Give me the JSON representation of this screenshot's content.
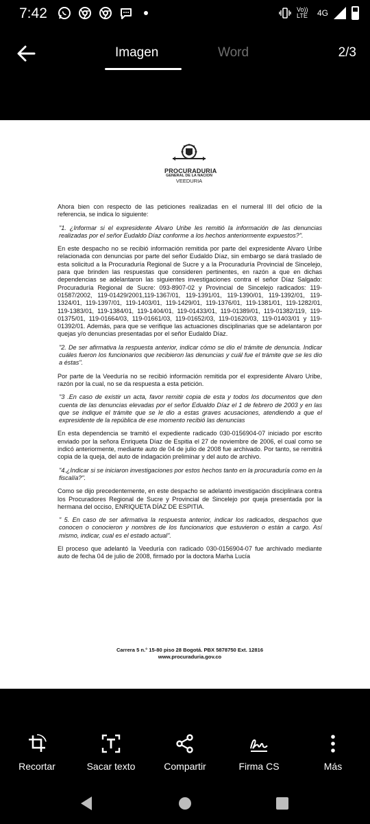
{
  "status": {
    "time": "7:42",
    "volte": "Vo)) LTE",
    "network": "4G"
  },
  "header": {
    "tabs": [
      "Imagen",
      "Word"
    ],
    "active_tab": "Imagen",
    "page_indicator": "2/3"
  },
  "document": {
    "logo": {
      "name": "PROCURADURIA",
      "subtitle": "GENERAL DE LA NACION",
      "unit": "VEEDURIA"
    },
    "paragraphs": [
      {
        "style": "normal",
        "text": "Ahora bien con respecto de las peticiones realizadas en el numeral III del oficio de la referencia, se indica lo siguiente:"
      },
      {
        "style": "italic",
        "text": "\"1. ¿Informar si el expresidente Alvaro Uribe les remitió la información de las denuncias realizadas por el señor Eudaldo Díaz conforme a los hechos anteriormente expuestos?\"."
      },
      {
        "style": "normal",
        "text": "En este despacho no se recibió información remitida por parte del expresidente Alvaro Uribe relacionada con denuncias por parte del señor Eudaldo Díaz, sin embargo se dará traslado de esta solicitud a la Procuraduría Regional de Sucre y a la Procuraduría Provincial de Sincelejo, para que brinden las respuestas que consideren pertinentes, en razón a que en dichas dependencias se adelantaron las siguientes investigaciones contra el señor Díaz Salgado: Procuraduría Regional de Sucre: 093-8907-02 y Provincial de Sincelejo radicados: 119-01587/2002, 119-01429/2001,119-1367/01, 119-1391/01, 119-1390/01, 119-1392/01, 119-1324/01, 119-1397/01, 119-1403/01, 119-1429/01, 119-1376/01, 119-1381/01, 119-1282/01, 119-1383/01, 119-1384/01, 119-1404/01, 119-01433/01, 119-01389/01, 119-01382/119, 119-01375/01, 119-01664/03, 119-01661/03, 119-01652/03, 119-01620/03, 119-01403/01 y 119-01392/01. Además, para que se verifique las actuaciones disciplinarias que se adelantaron por quejas y/o denuncias presentadas por el señor Eudaldo Díaz."
      },
      {
        "style": "italic",
        "text": "\"2. De ser afirmativa la respuesta anterior, indicar cómo se dio el trámite de denuncia. Indicar cuáles fueron los funcionarios que recibieron las denuncias y cuál fue el trámite que se les dio a éstas\"."
      },
      {
        "style": "normal",
        "text": "Por parte de la Veeduría no se recibió información remitida por el expresidente Alvaro Uribe, razón por la cual, no se da respuesta a esta petición."
      },
      {
        "style": "italic",
        "text": "\"3 .En caso de existir un acta, favor remitir copia de esta y todos los documentos que den cuenta de las denuncias elevadas por el señor Edualdo Díaz el 1 de febrero de 2003 y en las que se indique el trámite que se le dio a estas graves acusaciones, atendiendo a que el expresidente de la república de ese momento recibió las denuncias"
      },
      {
        "style": "normal",
        "text": "En esta dependencia se tramitó el expediente radicado 030-0156904-07 iniciado por escrito enviado por la señora Enriqueta Díaz de Espitia el 27 de noviembre de 2006, el cual como se indicó anteriormente, mediante auto de 04 de julio de 2008 fue archivado. Por tanto, se remitirá copia de la queja, del auto de indagación preliminar y del auto de archivo."
      },
      {
        "style": "italic",
        "text": "\"4.¿Indicar si se iniciaron investigaciones por estos hechos tanto en la procuraduría como en la fiscalía?\"."
      },
      {
        "style": "normal",
        "text": "Como se dijo precedentemente, en este despacho se adelantó investigación disciplinara contra los Procuradores Regional de Sucre y Provincial de Sincelejo por queja presentada por la hermana del occiso, ENRIQUETA DÍAZ DE ESPITIA."
      },
      {
        "style": "italic",
        "text": "\" 5. En caso de ser afirmativa la respuesta anterior, indicar los radicados, despachos que conocen o conocieron y nombres de los funcionarios que estuvieron o están a cargo. Así mismo, indicar, cual es el estado actual\"."
      },
      {
        "style": "normal",
        "text": "El proceso que adelantó la Veeduría con radicado 030-0156904-07 fue archivado mediante auto de fecha 04 de julio de 2008, firmado por la doctora Marha Lucía"
      }
    ],
    "footer": {
      "address": "Carrera 5 n.° 15-80 piso 28 Bogotá. PBX 5878750 Ext. 12816",
      "website": "www.procuraduria.gov.co"
    }
  },
  "toolbar": {
    "items": [
      {
        "label": "Recortar",
        "icon": "crop-icon"
      },
      {
        "label": "Sacar texto",
        "icon": "extract-text-icon"
      },
      {
        "label": "Compartir",
        "icon": "share-icon"
      },
      {
        "label": "Firma CS",
        "icon": "signature-icon"
      },
      {
        "label": "Más",
        "icon": "more-vertical-icon"
      }
    ]
  }
}
